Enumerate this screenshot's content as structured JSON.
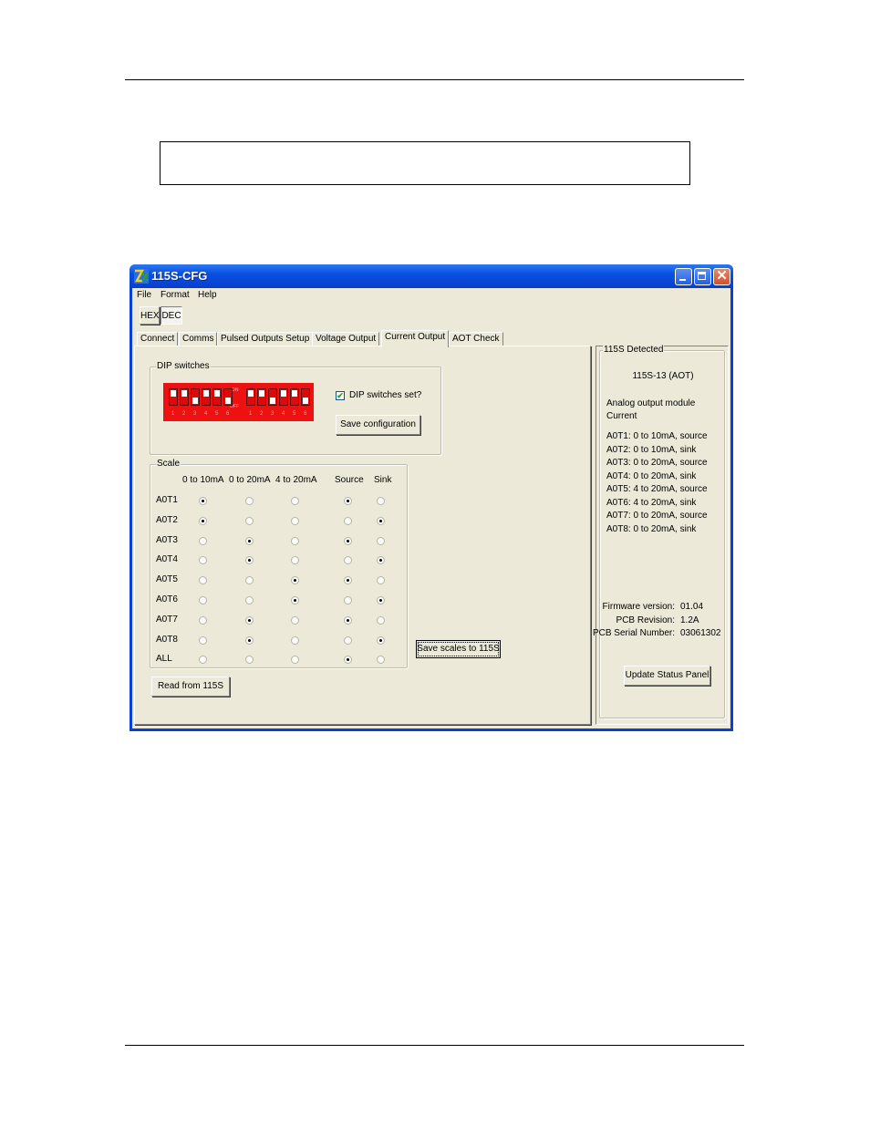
{
  "document": {
    "text_box_content": ""
  },
  "window": {
    "title": "115S-CFG",
    "app_icon": "zx-logo-icon",
    "controls": {
      "minimize": "minimize-icon",
      "maximize": "maximize-icon",
      "close": "close-icon",
      "close_glyph": "✕"
    }
  },
  "menubar": {
    "items": [
      "File",
      "Format",
      "Help"
    ]
  },
  "number_format": {
    "hex_label": "HEX",
    "dec_label": "DEC",
    "selected": "DEC"
  },
  "tabs": {
    "items": [
      "Connect",
      "Comms",
      "Pulsed Outputs Setup",
      "Voltage Output",
      "Current Output",
      "AOT Check"
    ],
    "active": "Current Output"
  },
  "dip_switches": {
    "title": "DIP switches",
    "on_label": "ON",
    "off_label": "OFF",
    "banks": [
      {
        "numbers": [
          "1",
          "2",
          "3",
          "4",
          "5",
          "6"
        ],
        "states": [
          "on",
          "on",
          "off",
          "on",
          "on",
          "off"
        ]
      },
      {
        "numbers": [
          "1",
          "2",
          "3",
          "4",
          "5",
          "6"
        ],
        "states": [
          "on",
          "on",
          "off",
          "on",
          "on",
          "off"
        ]
      }
    ],
    "checkbox_label": "DIP switches set?",
    "checkbox_checked": true,
    "checkbox_glyph": "✔",
    "save_button": "Save configuration"
  },
  "scale": {
    "title": "Scale",
    "columns": [
      "0 to 10mA",
      "0 to 20mA",
      "4 to 20mA",
      "Source",
      "Sink"
    ],
    "rows": [
      {
        "label": "A0T1",
        "range": "0 to 10mA",
        "mode": "Source"
      },
      {
        "label": "A0T2",
        "range": "0 to 10mA",
        "mode": "Sink"
      },
      {
        "label": "A0T3",
        "range": "0 to 20mA",
        "mode": "Source"
      },
      {
        "label": "A0T4",
        "range": "0 to 20mA",
        "mode": "Sink"
      },
      {
        "label": "A0T5",
        "range": "4 to 20mA",
        "mode": "Source"
      },
      {
        "label": "A0T6",
        "range": "4 to 20mA",
        "mode": "Sink"
      },
      {
        "label": "A0T7",
        "range": "0 to 20mA",
        "mode": "Source"
      },
      {
        "label": "A0T8",
        "range": "0 to 20mA",
        "mode": "Sink"
      },
      {
        "label": "ALL",
        "range": "",
        "mode": "Source"
      }
    ],
    "save_button": "Save scales to 115S",
    "read_button": "Read from 115S"
  },
  "status_panel": {
    "title": "115S Detected",
    "model": "115S-13 (AOT)",
    "module_type": "Analog output module",
    "module_subtype": "Current",
    "channels": [
      "A0T1: 0 to 10mA, source",
      "A0T2: 0 to 10mA, sink",
      "A0T3: 0 to 20mA, source",
      "A0T4: 0 to 20mA, sink",
      "A0T5: 4 to 20mA, source",
      "A0T6: 4 to 20mA, sink",
      "A0T7: 0 to 20mA, source",
      "A0T8: 0 to 20mA, sink"
    ],
    "firmware_label": "Firmware version:",
    "firmware_value": "01.04",
    "pcb_revision_label": "PCB Revision:",
    "pcb_revision_value": "1.2A",
    "pcb_serial_label": "PCB Serial Number:",
    "pcb_serial_value": "03061302",
    "update_button": "Update Status Panel"
  }
}
